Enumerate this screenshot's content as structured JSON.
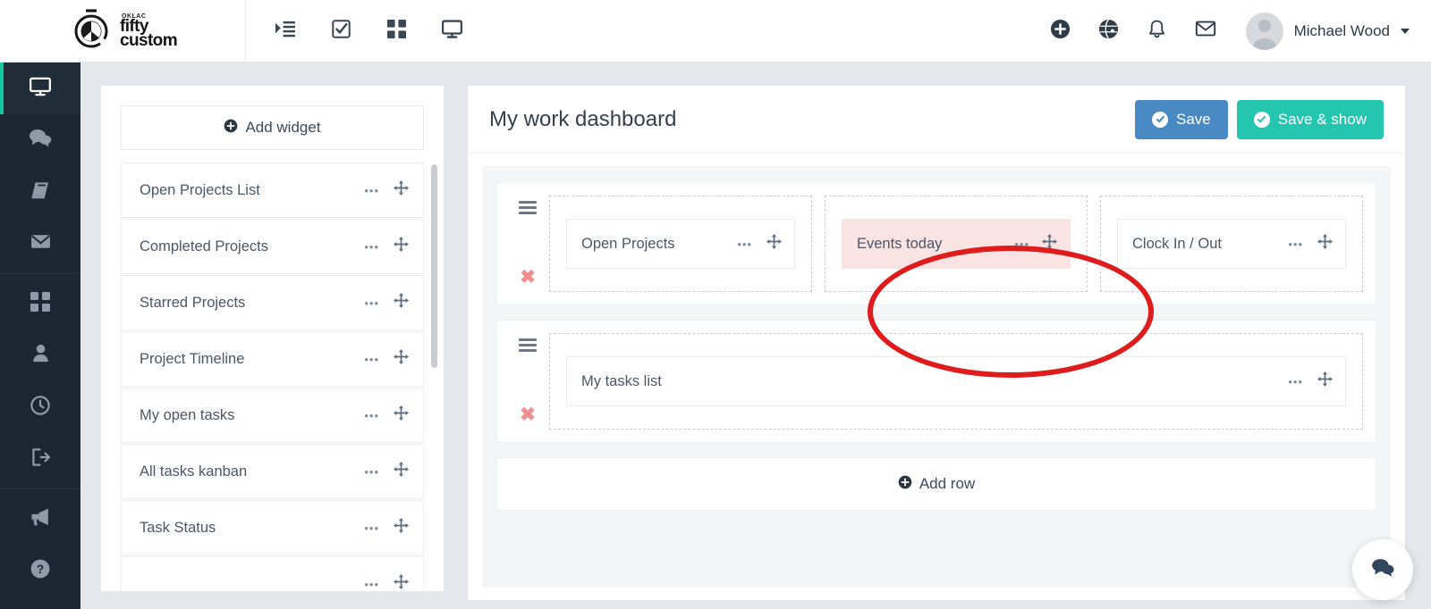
{
  "brand": {
    "tiny": "OKLAC",
    "line1": "fifty",
    "line2": "custom"
  },
  "topnav": {
    "items": [
      {
        "name": "indent-list-icon",
        "label": "Projects"
      },
      {
        "name": "check-square-icon",
        "label": "Tasks"
      },
      {
        "name": "grid-icon",
        "label": "Modules"
      },
      {
        "name": "monitor-icon",
        "label": "Dashboards"
      }
    ]
  },
  "topright": {
    "icons": [
      {
        "name": "plus-circle-icon",
        "label": "Add"
      },
      {
        "name": "globe-icon",
        "label": "Language"
      },
      {
        "name": "bell-icon",
        "label": "Notifications"
      },
      {
        "name": "envelope-icon",
        "label": "Messages"
      }
    ],
    "user_name": "Michael Wood"
  },
  "sidebar": {
    "items": [
      {
        "name": "monitor-icon",
        "label": "Dashboard",
        "active": true
      },
      {
        "name": "chat-bubbles-icon",
        "label": "Chat",
        "active": false
      },
      {
        "name": "book-icon",
        "label": "Knowledge base",
        "active": false
      },
      {
        "name": "envelope-icon",
        "label": "Inbox",
        "active": false
      },
      {
        "name": "grid-icon",
        "label": "Apps",
        "active": false
      },
      {
        "name": "user-icon",
        "label": "Profile",
        "active": false
      },
      {
        "name": "clock-icon",
        "label": "Timesheets",
        "active": false
      },
      {
        "name": "logout-icon",
        "label": "Sign out",
        "active": false
      },
      {
        "name": "megaphone-icon",
        "label": "Announcements",
        "active": false
      },
      {
        "name": "help-circle-icon",
        "label": "Help",
        "active": false
      }
    ]
  },
  "widget_panel": {
    "add_widget_label": "Add widget",
    "items": [
      {
        "label": "Open Projects List"
      },
      {
        "label": "Completed Projects"
      },
      {
        "label": "Starred Projects"
      },
      {
        "label": "Project Timeline"
      },
      {
        "label": "My open tasks"
      },
      {
        "label": "All tasks kanban"
      },
      {
        "label": "Task Status"
      },
      {
        "label": ""
      }
    ]
  },
  "dashboard": {
    "title": "My work dashboard",
    "save_label": "Save",
    "save_show_label": "Save & show",
    "add_row_label": "Add row",
    "rows": [
      {
        "zones": [
          {
            "widget": "Open Projects",
            "highlight": false
          },
          {
            "widget": "Events today",
            "highlight": true
          },
          {
            "widget": "Clock In / Out",
            "highlight": false
          }
        ]
      },
      {
        "zones": [
          {
            "widget": "My tasks list",
            "highlight": false
          }
        ]
      }
    ]
  },
  "colors": {
    "save_button": "#4989c4",
    "save_show_button": "#25c6b0",
    "sidebar_bg": "#1d2733",
    "sidebar_accent": "#13c7a0",
    "highlight_widget_bg": "#f9e3e3",
    "annotation": "#e01b1b",
    "delete_x": "#ef8e8e"
  },
  "annotation": {
    "shape": "ellipse",
    "targets": "Events today"
  },
  "chat_fab": {
    "name": "chat-bubbles-icon",
    "label": "Chat"
  }
}
